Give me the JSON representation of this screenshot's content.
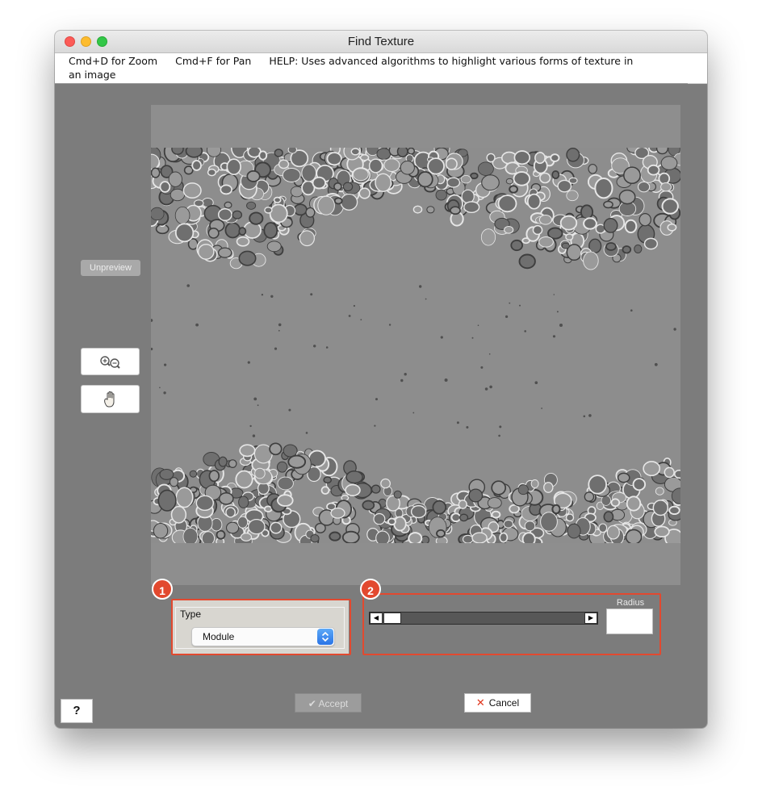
{
  "window": {
    "title": "Find Texture",
    "help_line_1": [
      "Cmd+D for Zoom",
      "Cmd+F for Pan",
      "HELP:  Uses advanced algorithms to highlight various forms of texture in"
    ],
    "help_line_2": "an image"
  },
  "sidebar": {
    "unpreview_label": "Unpreview",
    "zoom_icon": "zoom-in-out-icon",
    "pan_icon": "hand-pan-icon"
  },
  "annotations": {
    "badge_1": "1",
    "badge_2": "2",
    "highlight_color": "#e2492f"
  },
  "type_group": {
    "legend": "Type",
    "selected": "Module"
  },
  "radius_group": {
    "label": "Radius",
    "value": "",
    "slider_position": 0.0
  },
  "footer": {
    "accept_label": "Accept",
    "accept_icon": "checkmark-icon",
    "cancel_label": "Cancel",
    "cancel_icon": "x-icon",
    "help_label": "?"
  },
  "preview": {
    "image_description_icon": "microscopy-image"
  }
}
